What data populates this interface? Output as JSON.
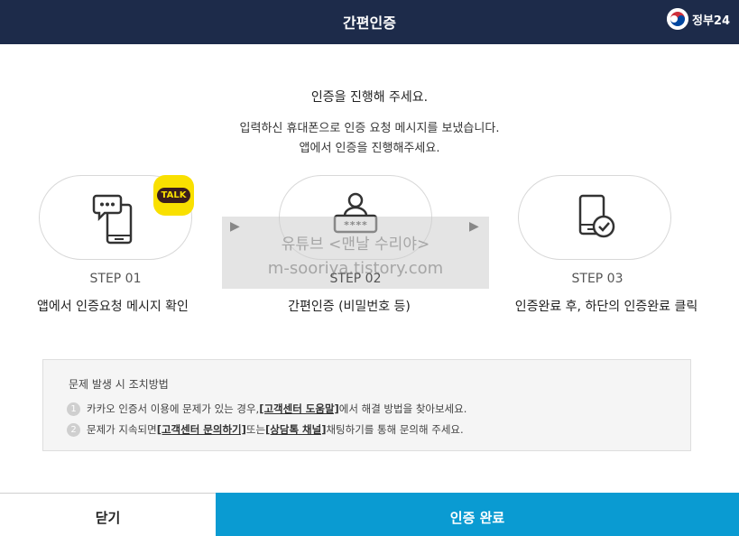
{
  "header": {
    "title": "간편인증",
    "gov_logo_text": "정부24",
    "colors": {
      "background": "#1d2b4a",
      "text": "#ffffff"
    }
  },
  "intro": {
    "line1": "인증을 진행해 주세요.",
    "line2": "입력하신 휴대폰으로 인증 요청 메시지를 보냈습니다.",
    "line3": "앱에서 인증을 진행해주세요."
  },
  "steps": [
    {
      "number": "STEP 01",
      "description": "앱에서 인증요청 메시지 확인",
      "icon": "phone-message-icon"
    },
    {
      "number": "STEP 02",
      "description": "간편인증 (비밀번호 등)",
      "icon": "user-password-icon"
    },
    {
      "number": "STEP 03",
      "description": "인증완료 후, 하단의 인증완료 클릭",
      "icon": "phone-check-icon"
    }
  ],
  "talk_badge": {
    "label": "TALK",
    "color": "#f9e000"
  },
  "arrows": [
    "▶",
    "▶"
  ],
  "watermark": {
    "line1": "유튜브 <맨날 수리야>",
    "line2": "m-sooriya.tistory.com"
  },
  "help": {
    "title": "문제 발생 시 조치방법",
    "items": [
      {
        "num": "1",
        "prefix": "카카오 인증서 이용에 문제가 있는 경우, ",
        "link": "[고객센터 도움말]",
        "suffix": " 에서 해결 방법을 찾아보세요."
      },
      {
        "num": "2",
        "prefix": "문제가 지속되면 ",
        "link": "[고객센터 문의하기]",
        "middle": " 또는 ",
        "link2": "[상담톡 채널]",
        "suffix": " 채팅하기를 통해 문의해 주세요."
      }
    ]
  },
  "footer": {
    "close_label": "닫기",
    "done_label": "인증 완료",
    "done_color": "#0a9bd2"
  }
}
